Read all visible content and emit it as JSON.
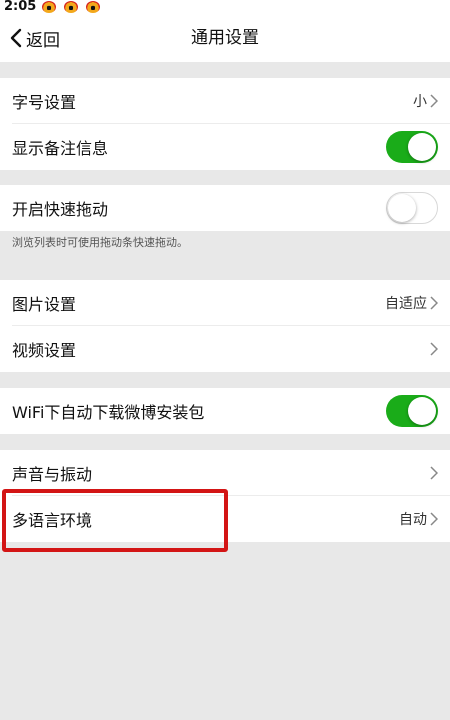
{
  "status_bar": {
    "time": "2:05",
    "icons": [
      "weibo-icon",
      "weibo-icon",
      "weibo-icon"
    ]
  },
  "nav": {
    "back_label": "返回",
    "title": "通用设置"
  },
  "groups": {
    "font": {
      "font_size_label": "字号设置",
      "font_size_value": "小",
      "show_remarks_label": "显示备注信息",
      "show_remarks_on": true
    },
    "drag": {
      "quick_drag_label": "开启快速拖动",
      "quick_drag_on": false,
      "quick_drag_hint": "浏览列表时可使用拖动条快速拖动。"
    },
    "media": {
      "image_label": "图片设置",
      "image_value": "自适应",
      "video_label": "视频设置"
    },
    "wifi": {
      "wifi_download_label": "WiFi下自动下载微博安装包",
      "wifi_download_on": true
    },
    "misc": {
      "sound_label": "声音与振动",
      "language_label": "多语言环境",
      "language_value": "自动"
    }
  },
  "colors": {
    "toggle_on": "#1aac19",
    "highlight": "#d31515",
    "background": "#e8e8e8"
  }
}
